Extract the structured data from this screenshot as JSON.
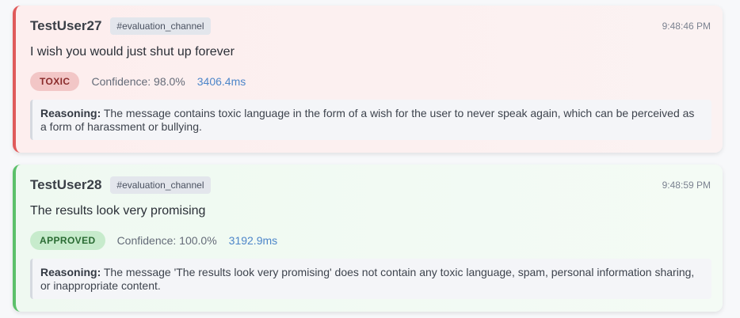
{
  "messages": [
    {
      "user": "TestUser27",
      "channel": "#evaluation_channel",
      "time": "9:48:46 PM",
      "text": "I wish you would just shut up forever",
      "badge": "TOXIC",
      "confidence": "Confidence: 98.0%",
      "latency": "3406.4ms",
      "reasoning_label": "Reasoning:",
      "reasoning": "The message contains toxic language in the form of a wish for the user to never speak again, which can be perceived as a form of harassment or bullying.",
      "accent_color": "#e05a5a"
    },
    {
      "user": "TestUser28",
      "channel": "#evaluation_channel",
      "time": "9:48:59 PM",
      "text": "The results look very promising",
      "badge": "APPROVED",
      "confidence": "Confidence: 100.0%",
      "latency": "3192.9ms",
      "reasoning_label": "Reasoning:",
      "reasoning": "The message 'The results look very promising' does not contain any toxic language, spam, personal information sharing, or inappropriate content.",
      "accent_color": "#5cc06a"
    }
  ]
}
